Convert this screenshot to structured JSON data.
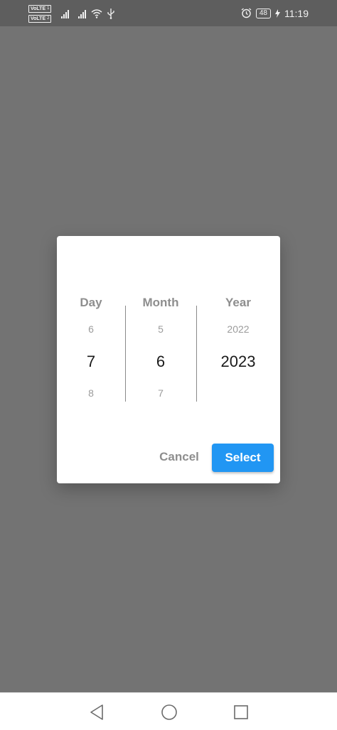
{
  "status_bar": {
    "volte_1": "VoLTE",
    "volte_1_sub": "1",
    "volte_2": "VoLTE",
    "volte_2_sub": "2",
    "battery": "48",
    "time": "11:19"
  },
  "picker": {
    "day": {
      "label": "Day",
      "prev": "6",
      "current": "7",
      "next": "8"
    },
    "month": {
      "label": "Month",
      "prev": "5",
      "current": "6",
      "next": "7"
    },
    "year": {
      "label": "Year",
      "prev": "2022",
      "current": "2023",
      "next": ""
    }
  },
  "actions": {
    "cancel_label": "Cancel",
    "select_label": "Select"
  },
  "colors": {
    "accent": "#2196f3",
    "scrim": "#737373"
  },
  "icons": [
    "alarm-icon",
    "battery-icon",
    "charging-icon",
    "wifi-icon",
    "usb-icon",
    "signal-icon",
    "back-icon",
    "home-icon",
    "recent-apps-icon"
  ]
}
